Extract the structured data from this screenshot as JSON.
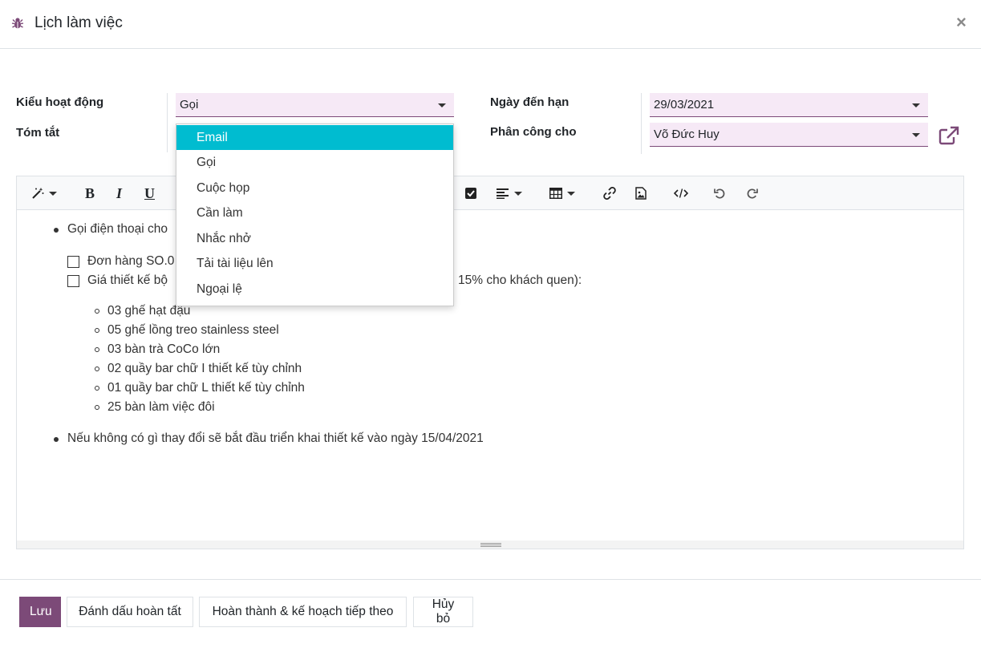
{
  "dialog": {
    "title": "Lịch làm việc",
    "close_glyph": "×",
    "icon": "bug-icon"
  },
  "form": {
    "activity_type": {
      "label": "Kiểu hoạt động",
      "value": "Gọi"
    },
    "summary": {
      "label": "Tóm tắt",
      "value": ""
    },
    "due_date": {
      "label": "Ngày đến hạn",
      "value": "29/03/2021"
    },
    "assigned_to": {
      "label": "Phân công cho",
      "value": "Võ Đức Huy"
    }
  },
  "dropdown": {
    "items": [
      "Email",
      "Gọi",
      "Cuộc họp",
      "Cần làm",
      "Nhắc nhở",
      "Tải tài liệu lên",
      "Ngoại lệ"
    ],
    "highlighted": "Email"
  },
  "toolbar": {
    "bold": "B",
    "italic": "I",
    "underline": "U",
    "icons": [
      "magic-wand-icon",
      "bold-icon",
      "italic-icon",
      "underline-icon",
      "checklist-icon",
      "align-icon",
      "table-icon",
      "link-icon",
      "image-icon",
      "code-view-icon",
      "undo-icon",
      "redo-icon"
    ]
  },
  "note": {
    "b1": "Gọi điện thoại cho",
    "c1": "Đơn hàng SO.0",
    "c2a": "Giá thiết kế bộ",
    "c2b": "15% cho khách quen):",
    "sub": [
      "03 ghế hạt đậu",
      "05 ghế lồng treo stainless steel",
      "03 bàn trà CoCo lớn",
      "02 quầy bar chữ I thiết kế tùy chỉnh",
      "01 quầy bar chữ L thiết kế tùy chỉnh",
      "25 bàn làm việc đôi"
    ],
    "b2": "Nếu không có gì thay đổi sẽ bắt đầu triển khai thiết kế vào ngày 15/04/2021"
  },
  "footer": {
    "save": "Lưu",
    "mark_done": "Đánh dấu hoàn tất",
    "done_schedule_next": "Hoàn thành & kế hoạch tiếp theo",
    "discard": "Hủy bỏ"
  },
  "colors": {
    "primary": "#7c4a78",
    "field_bg": "#f6e9f6",
    "highlight": "#00bcd0"
  }
}
